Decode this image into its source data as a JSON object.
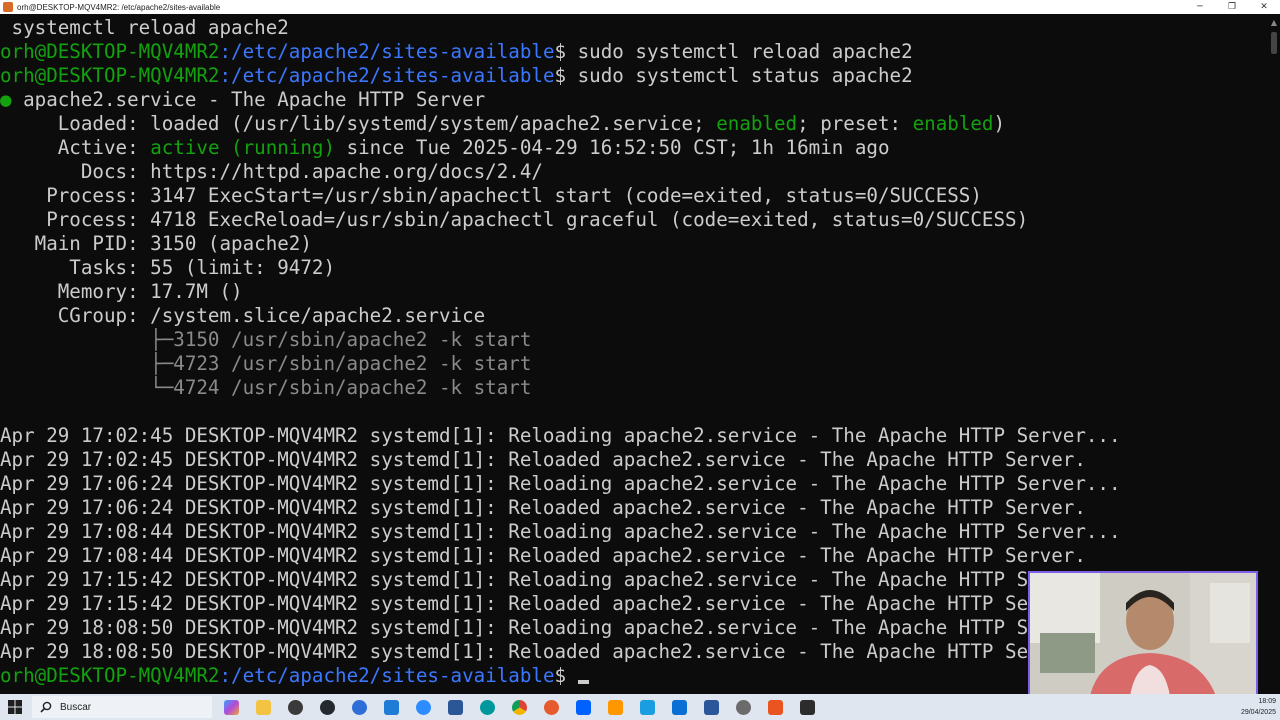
{
  "window": {
    "title": "orh@DESKTOP-MQV4MR2: /etc/apache2/sites-available",
    "controls": {
      "minimize": "─",
      "maximize": "❐",
      "close": "✕"
    }
  },
  "terminal": {
    "prompt_user": "orh@DESKTOP-MQV4MR2",
    "prompt_path": ":/etc/apache2/sites-available",
    "prompt_symbol": "$",
    "lines": {
      "l0": " systemctl reload apache2",
      "l1_cmd": " sudo systemctl reload apache2",
      "l2_cmd": " sudo systemctl status apache2",
      "l3_dot": "●",
      "l3": " apache2.service - The Apache HTTP Server",
      "l4_a": "     Loaded: loaded (/usr/lib/systemd/system/apache2.service; ",
      "l4_en1": "enabled",
      "l4_b": "; preset: ",
      "l4_en2": "enabled",
      "l4_c": ")",
      "l5_a": "     Active: ",
      "l5_active": "active (running)",
      "l5_b": " since Tue 2025-04-29 16:52:50 CST; 1h 16min ago",
      "l6": "       Docs: https://httpd.apache.org/docs/2.4/",
      "l7": "    Process: 3147 ExecStart=/usr/sbin/apachectl start (code=exited, status=0/SUCCESS)",
      "l8": "    Process: 4718 ExecReload=/usr/sbin/apachectl graceful (code=exited, status=0/SUCCESS)",
      "l9": "   Main PID: 3150 (apache2)",
      "l10": "      Tasks: 55 (limit: 9472)",
      "l11": "     Memory: 17.7M ()",
      "l12": "     CGroup: /system.slice/apache2.service",
      "l13": "             ├─3150 /usr/sbin/apache2 -k start",
      "l14": "             ├─4723 /usr/sbin/apache2 -k start",
      "l15": "             └─4724 /usr/sbin/apache2 -k start",
      "l16": "",
      "l17": "Apr 29 17:02:45 DESKTOP-MQV4MR2 systemd[1]: Reloading apache2.service - The Apache HTTP Server...",
      "l18": "Apr 29 17:02:45 DESKTOP-MQV4MR2 systemd[1]: Reloaded apache2.service - The Apache HTTP Server.",
      "l19": "Apr 29 17:06:24 DESKTOP-MQV4MR2 systemd[1]: Reloading apache2.service - The Apache HTTP Server...",
      "l20": "Apr 29 17:06:24 DESKTOP-MQV4MR2 systemd[1]: Reloaded apache2.service - The Apache HTTP Server.",
      "l21": "Apr 29 17:08:44 DESKTOP-MQV4MR2 systemd[1]: Reloading apache2.service - The Apache HTTP Server...",
      "l22": "Apr 29 17:08:44 DESKTOP-MQV4MR2 systemd[1]: Reloaded apache2.service - The Apache HTTP Server.",
      "l23": "Apr 29 17:15:42 DESKTOP-MQV4MR2 systemd[1]: Reloading apache2.service - The Apache HTTP Ser",
      "l24": "Apr 29 17:15:42 DESKTOP-MQV4MR2 systemd[1]: Reloaded apache2.service - The Apache HTTP Serv",
      "l25": "Apr 29 18:08:50 DESKTOP-MQV4MR2 systemd[1]: Reloading apache2.service - The Apache HTTP Ser",
      "l26": "Apr 29 18:08:50 DESKTOP-MQV4MR2 systemd[1]: Reloaded apache2.service - The Apache HTTP Serv"
    }
  },
  "colors": {
    "background": "#0c0c0c",
    "text": "#cccccc",
    "prompt_green": "#13a10e",
    "path_blue": "#3b78ff",
    "webcam_border": "#7d5fe8"
  },
  "taskbar": {
    "search_label": "Buscar",
    "clock_time": "18:09",
    "clock_date": "29/04/2025",
    "icons": [
      "windows-start-icon",
      "search-icon",
      "copilot-icon",
      "file-explorer-icon",
      "chrome-icon",
      "obs-icon",
      "edge-icon",
      "vscode-icon",
      "zoom-icon",
      "powershell-icon",
      "arduino-icon",
      "chrome-icon-2",
      "firefox-icon",
      "dropbox-icon",
      "sublime-icon",
      "snipping-icon",
      "outlook-icon",
      "word-icon",
      "settings-icon",
      "wsl-icon",
      "terminal-icon"
    ]
  }
}
